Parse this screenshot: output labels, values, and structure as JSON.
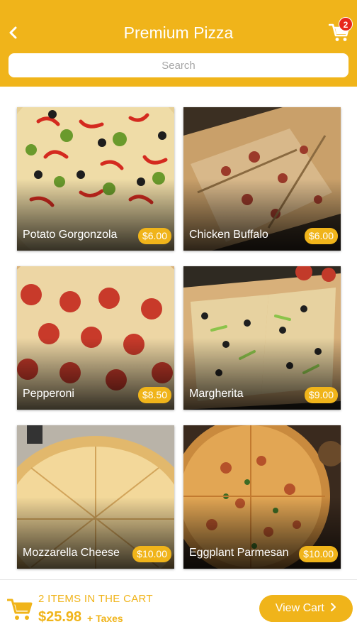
{
  "header": {
    "title": "Premium Pizza",
    "cart_count": "2",
    "back_icon": "chevron-left-icon",
    "cart_icon": "shopping-cart-icon",
    "search_placeholder": "Search"
  },
  "products": [
    {
      "name": "Potato Gorgonzola",
      "price": "$6.00"
    },
    {
      "name": "Chicken Buffalo",
      "price": "$6.00"
    },
    {
      "name": "Pepperoni",
      "price": "$8.50"
    },
    {
      "name": "Margherita",
      "price": "$9.00"
    },
    {
      "name": "Mozzarella Cheese",
      "price": "$10.00"
    },
    {
      "name": "Eggplant Parmesan",
      "price": "$10.00"
    }
  ],
  "footer": {
    "items_text": "2 ITEMS IN THE CART",
    "total": "$25.98",
    "taxes": "+ Taxes",
    "view_cart_label": "View Cart",
    "cart_icon": "shopping-cart-icon"
  },
  "colors": {
    "accent": "#f0b41a",
    "badge": "#e8281c"
  }
}
